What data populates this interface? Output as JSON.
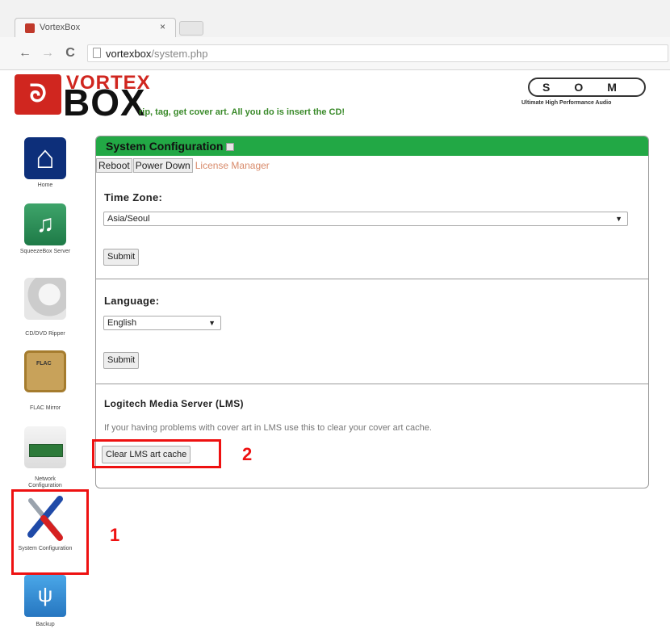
{
  "browser": {
    "tab_title": "VortexBox",
    "tab_close": "×",
    "url_host": "vortexbox",
    "url_path": "/system.php",
    "back": "←",
    "forward": "→",
    "reload": "C"
  },
  "header": {
    "logo_mark": "ᘐ",
    "logo_top": "VORTEX",
    "logo_bottom": "BOX",
    "tagline": "rip, tag, get cover art. All you do is insert the CD!",
    "som_text": "SOM",
    "som_sub": "Ultimate High Performance Audio"
  },
  "sidebar": {
    "items": [
      {
        "label": "Home",
        "icon": "home-icon"
      },
      {
        "label": "SqueezeBox Server",
        "icon": "music-icon"
      },
      {
        "label": "CD/DVD Ripper",
        "icon": "cd-icon"
      },
      {
        "label": "FLAC Mirror",
        "icon": "flac-icon"
      },
      {
        "label": "Network Configuration",
        "icon": "network-card-icon"
      },
      {
        "label": "System Configuration",
        "icon": "tools-icon"
      },
      {
        "label": "Backup",
        "icon": "usb-drive-icon"
      }
    ]
  },
  "panel": {
    "title": "System Configuration",
    "buttons": {
      "reboot": "Reboot",
      "power_down": "Power Down",
      "license_manager": "License Manager"
    },
    "timezone": {
      "label": "Time Zone:",
      "value": "Asia/Seoul",
      "submit": "Submit"
    },
    "language": {
      "label": "Language:",
      "value": "English",
      "submit": "Submit"
    },
    "lms": {
      "label": "Logitech Media Server (LMS)",
      "note": "If your having problems with cover art in LMS use this to clear your cover art cache.",
      "button": "Clear LMS art cache"
    }
  },
  "annotations": {
    "first": "1",
    "second": "2"
  },
  "colors": {
    "accent_green": "#22a845",
    "brand_red": "#d0261f",
    "annotation_red": "#ee1111"
  }
}
